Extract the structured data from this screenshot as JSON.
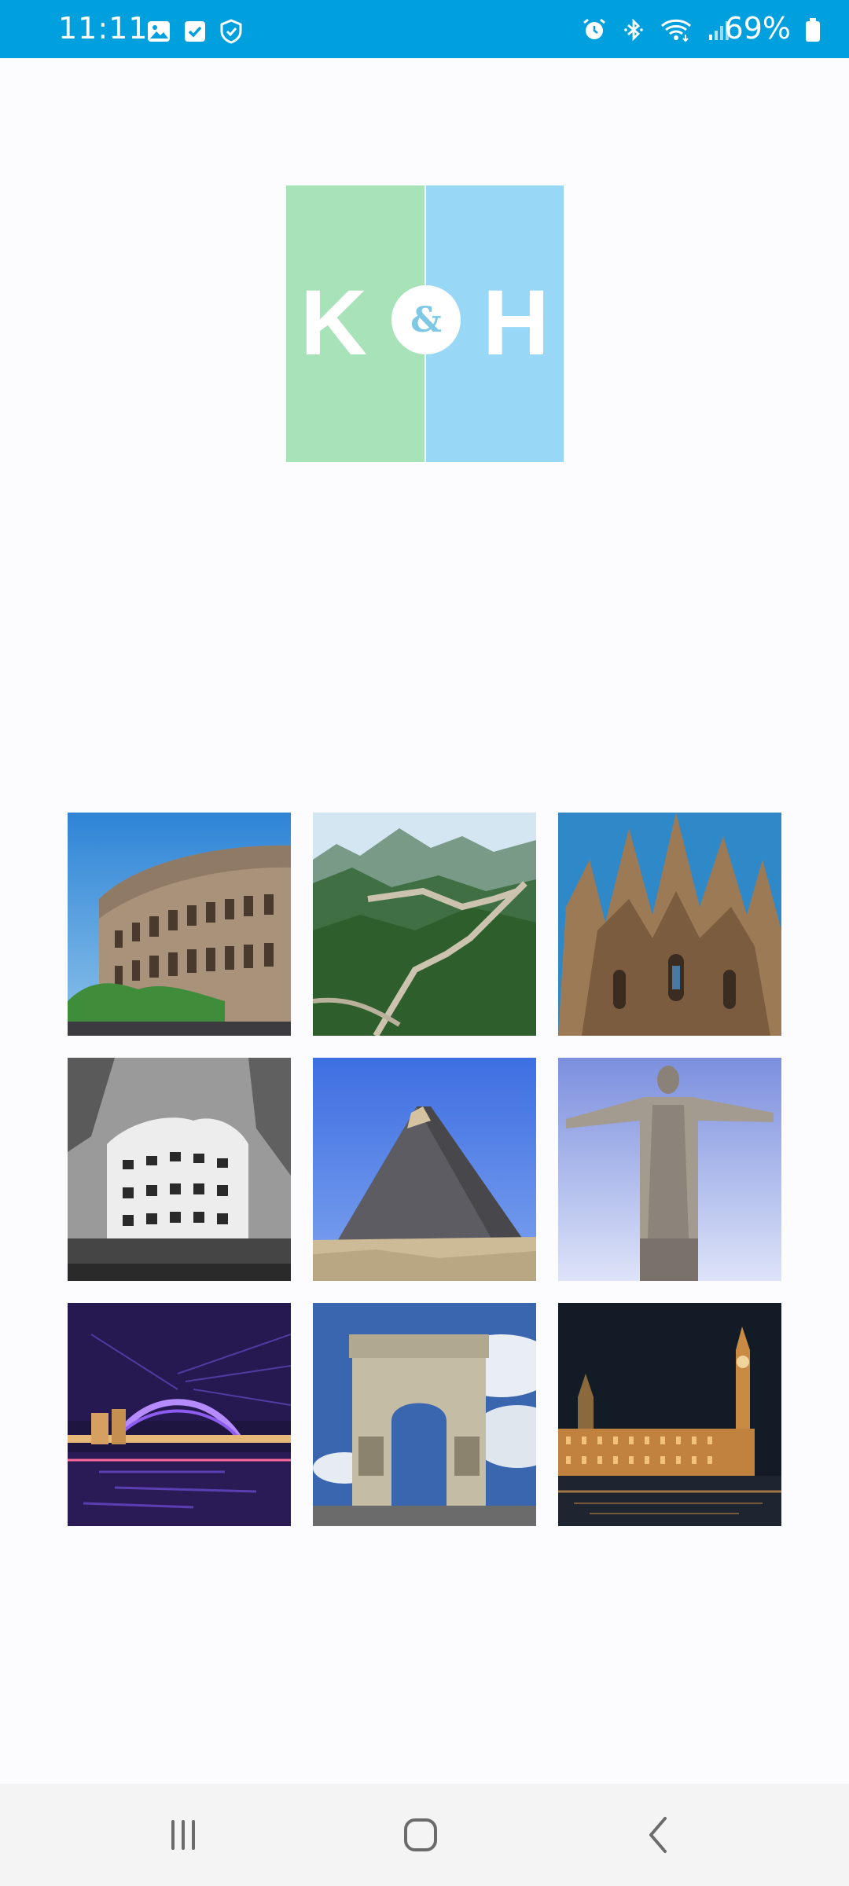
{
  "status_bar": {
    "time": "11:11",
    "battery": "69%",
    "left_icons": [
      "gallery-icon",
      "checkbox-icon",
      "shield-icon"
    ],
    "right_icons": [
      "alarm-icon",
      "bluetooth-icon",
      "wifi-icon",
      "signal-icon",
      "battery-icon"
    ]
  },
  "logo": {
    "left_letter": "K",
    "ampersand": "&",
    "right_letter": "H",
    "colors": {
      "left": "#a8e2b8",
      "right": "#98d8f6"
    }
  },
  "landmarks": [
    {
      "name": "colosseum"
    },
    {
      "name": "great-wall"
    },
    {
      "name": "sagrada-familia"
    },
    {
      "name": "casa-mila"
    },
    {
      "name": "pyramid"
    },
    {
      "name": "christ-the-redeemer"
    },
    {
      "name": "sydney-harbour-bridge"
    },
    {
      "name": "arc-de-triomphe"
    },
    {
      "name": "big-ben"
    }
  ],
  "nav_bar": {
    "buttons": [
      "recents-icon",
      "home-icon",
      "back-icon"
    ]
  },
  "colors": {
    "status_bar_bg": "#00a0df",
    "page_bg": "#fcfbfe",
    "nav_bg": "#f4f4f4"
  }
}
